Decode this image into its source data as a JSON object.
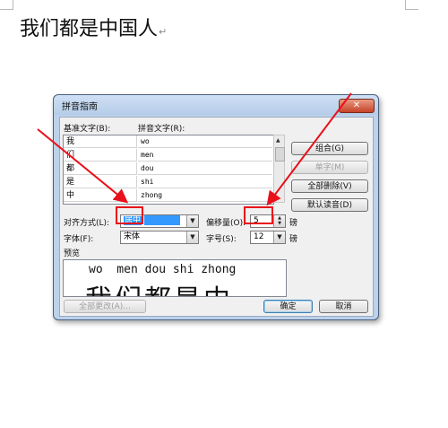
{
  "document": {
    "text": "我们都是中国人",
    "paragraph_mark": "↵"
  },
  "dialog": {
    "title": "拼音指南",
    "close_label": "✕",
    "base_text_header": "基准文字(B):",
    "ruby_text_header": "拼音文字(R):",
    "rows": [
      {
        "base": "我",
        "ruby": "wo"
      },
      {
        "base": "们",
        "ruby": "men"
      },
      {
        "base": "都",
        "ruby": "dou"
      },
      {
        "base": "是",
        "ruby": "shi"
      },
      {
        "base": "中",
        "ruby": "zhong"
      }
    ],
    "buttons": {
      "group": "组合(G)",
      "mono": "单字(M)",
      "clear_all": "全部删除(V)",
      "default_reading": "默认读音(D)",
      "apply_all": "全部更改(A)...",
      "ok": "确定",
      "cancel": "取消"
    },
    "alignment_label": "对齐方式(L):",
    "alignment_value": "居中",
    "offset_label": "偏移量(O):",
    "offset_value": "5",
    "offset_unit": "磅",
    "font_label": "字体(F):",
    "font_value": "宋体",
    "size_label": "字号(S):",
    "size_value": "12",
    "size_unit": "磅",
    "preview_label": "预览",
    "preview_ruby": "wo  men dou shi zhong",
    "preview_base": "我们都是中"
  },
  "colors": {
    "annotation_red": "#e8101a",
    "titlebar": "#bcd1ea",
    "selection_blue": "#3399ff"
  }
}
